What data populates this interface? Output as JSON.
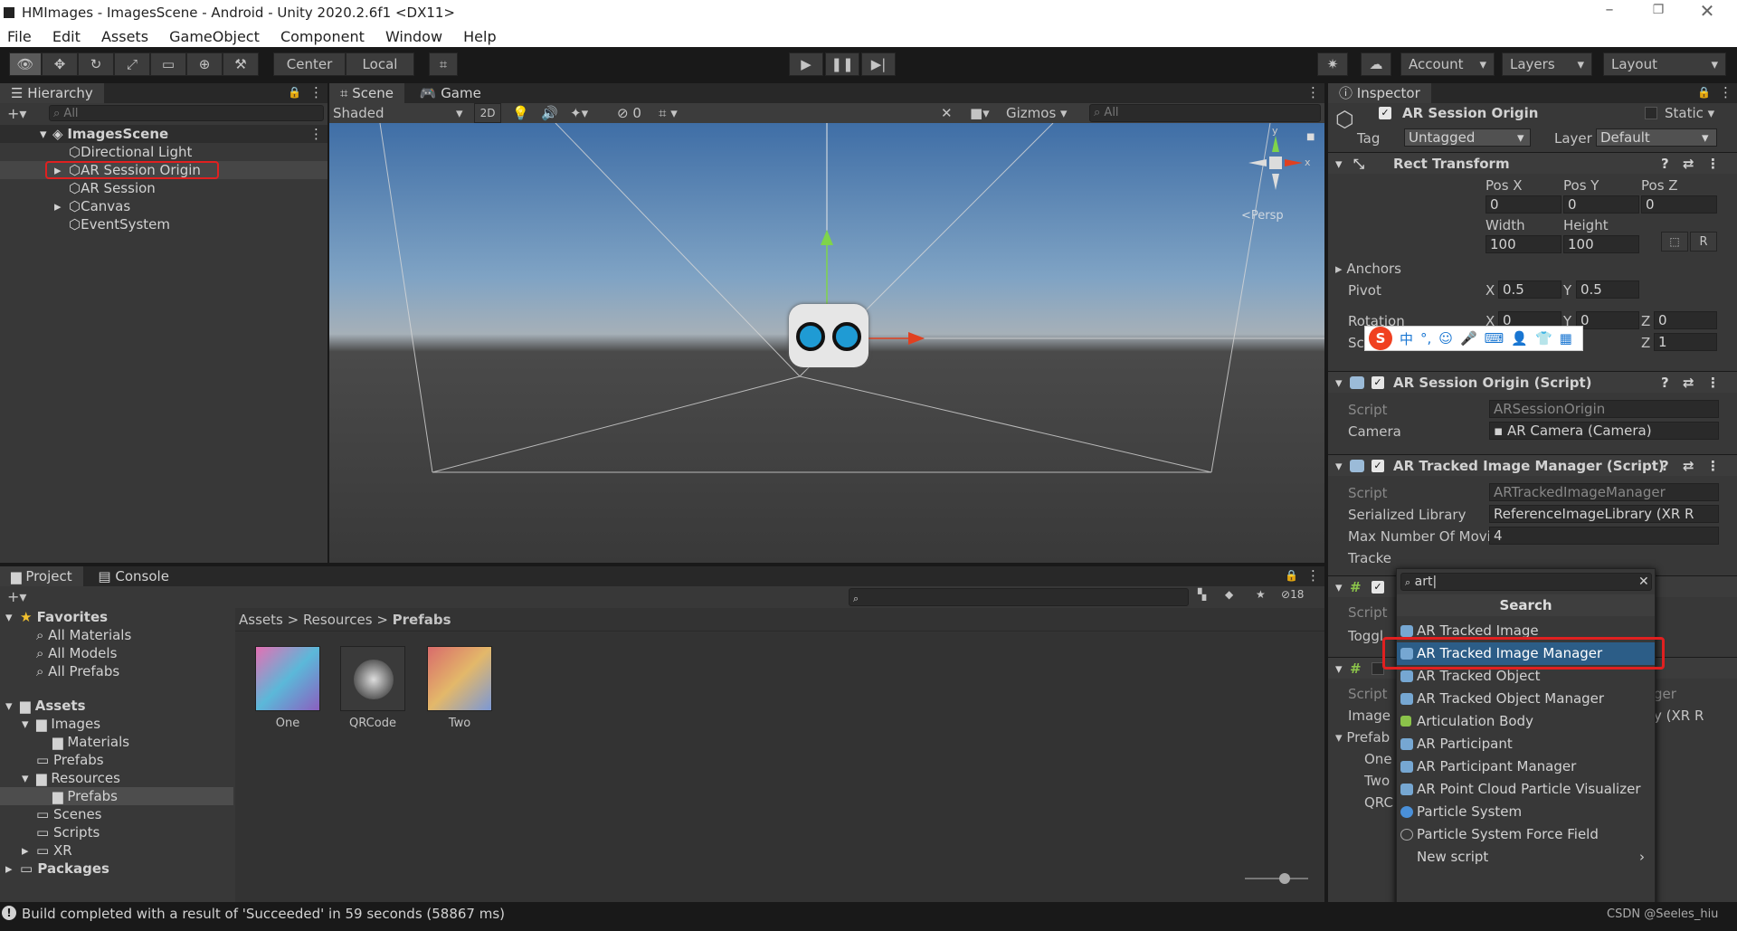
{
  "window": {
    "title": "HMImages - ImagesScene - Android - Unity 2020.2.6f1 <DX11>"
  },
  "menu": [
    "File",
    "Edit",
    "Assets",
    "GameObject",
    "Component",
    "Window",
    "Help"
  ],
  "toolbar": {
    "center": "Center",
    "local": "Local",
    "account": "Account",
    "layers": "Layers",
    "layout": "Layout"
  },
  "hierarchy": {
    "tab": "Hierarchy",
    "search_placeholder": "All",
    "scene": "ImagesScene",
    "items": [
      "Directional Light",
      "AR Session Origin",
      "AR Session",
      "Canvas",
      "EventSystem"
    ]
  },
  "scene": {
    "tab_scene": "Scene",
    "tab_game": "Game",
    "shading": "Shaded",
    "mode2d": "2D",
    "hidden_count": "0",
    "gizmos": "Gizmos",
    "search_placeholder": "All",
    "persp": "Persp",
    "axis_x": "x",
    "axis_y": "y"
  },
  "inspector": {
    "tab": "Inspector",
    "object_name": "AR Session Origin",
    "static": "Static",
    "tag_label": "Tag",
    "tag_value": "Untagged",
    "layer_label": "Layer",
    "layer_value": "Default",
    "rect_transform": {
      "title": "Rect Transform",
      "posx_label": "Pos X",
      "posy_label": "Pos Y",
      "posz_label": "Pos Z",
      "posx": "0",
      "posy": "0",
      "posz": "0",
      "width_label": "Width",
      "height_label": "Height",
      "width": "100",
      "height": "100",
      "r_button": "R",
      "anchors": "Anchors",
      "pivot": "Pivot",
      "pivot_x": "0.5",
      "pivot_y": "0.5",
      "rotation": "Rotation",
      "rot_x": "0",
      "rot_y": "0",
      "rot_z": "0",
      "scale": "Sc",
      "scale_z": "1",
      "x": "X",
      "y": "Y",
      "z": "Z"
    },
    "session_origin": {
      "title": "AR Session Origin (Script)",
      "script_label": "Script",
      "script_value": "ARSessionOrigin",
      "camera_label": "Camera",
      "camera_value": "AR Camera (Camera)"
    },
    "tracked_manager": {
      "title": "AR Tracked Image Manager (Script)",
      "script_label": "Script",
      "script_value": "ARTrackedImageManager",
      "lib_label": "Serialized Library",
      "lib_value": "ReferenceImageLibrary (XR R",
      "max_label": "Max Number Of Movi",
      "max_value": "4",
      "tracked_label": "Tracke"
    },
    "partial_rows": {
      "script": "Script",
      "toggle": "Toggl",
      "script2": "Script",
      "image": "Image l",
      "prefab": "Prefab",
      "one": "One",
      "two": "Two",
      "qrc": "QRC",
      "right_ger": "ger",
      "right_xr": "y (XR R"
    }
  },
  "add_component": {
    "search_value": "art",
    "header": "Search",
    "items": [
      "AR Tracked Image",
      "AR Tracked Image Manager",
      "AR Tracked Object",
      "AR Tracked Object Manager",
      "Articulation Body",
      "AR Participant",
      "AR Participant Manager",
      "AR Point Cloud Particle Visualizer",
      "Particle System",
      "Particle System Force Field",
      "New script"
    ],
    "selected_index": 1
  },
  "project": {
    "tab_project": "Project",
    "tab_console": "Console",
    "hidden_count": "18",
    "favorites": "Favorites",
    "fav_items": [
      "All Materials",
      "All Models",
      "All Prefabs"
    ],
    "assets": "Assets",
    "tree": [
      "Images",
      "Materials",
      "Prefabs",
      "Resources",
      "Prefabs",
      "Scenes",
      "Scripts",
      "XR"
    ],
    "packages": "Packages",
    "breadcrumb": [
      "Assets",
      "Resources",
      "Prefabs"
    ],
    "files": [
      "One",
      "QRCode",
      "Two"
    ]
  },
  "ime": {
    "items": [
      "中",
      "°,"
    ]
  },
  "status": {
    "message": "Build completed with a result of 'Succeeded' in 59 seconds (58867 ms)",
    "watermark": "CSDN @Seeles_hiu"
  },
  "colors": {
    "accent_red": "#e02020",
    "selection_blue": "#2c5d87",
    "panel": "#383838"
  }
}
